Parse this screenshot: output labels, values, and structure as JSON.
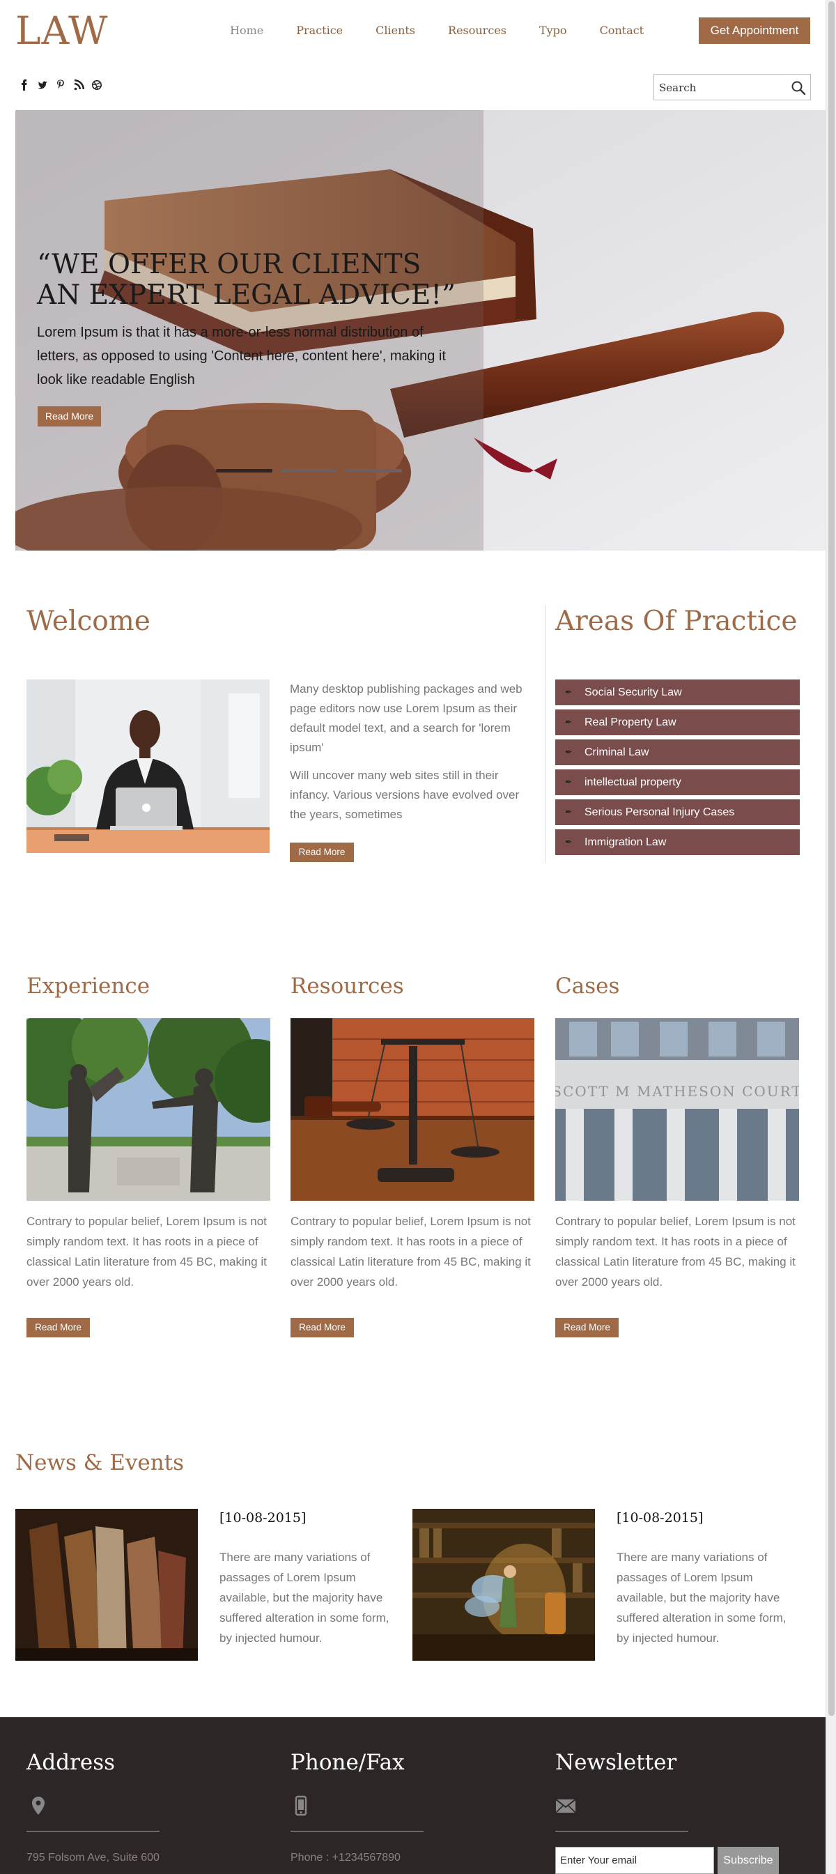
{
  "header": {
    "logo": "LAW",
    "nav": [
      "Home",
      "Practice",
      "Clients",
      "Resources",
      "Typo",
      "Contact"
    ],
    "appointment_button": "Get Appointment"
  },
  "social_icons": [
    "facebook-icon",
    "twitter-icon",
    "pinterest-icon",
    "rss-icon",
    "dribbble-icon"
  ],
  "search": {
    "placeholder": "Search"
  },
  "hero": {
    "quote": "“WE OFFER OUR CLIENTS AN EXPERT LEGAL ADVICE!”",
    "text": "Lorem Ipsum is that it has a more-or-less normal distribution of letters, as opposed to using 'Content here, content here', making it look like readable English",
    "button": "Read More",
    "slides": 3,
    "active_slide": 1
  },
  "welcome": {
    "title": "Welcome",
    "para1": "Many desktop publishing packages and web page editors now use Lorem Ipsum as their default model text, and a search for 'lorem ipsum'",
    "para2": "Will uncover many web sites still in their infancy. Various versions have evolved over the years, sometimes",
    "button": "Read More"
  },
  "practice": {
    "title": "Areas Of Practice",
    "items": [
      "Social Security Law",
      "Real Property Law",
      "Criminal Law",
      "intellectual property",
      "Serious Personal Injury Cases",
      "Immigration Law"
    ]
  },
  "columns": [
    {
      "title": "Experience",
      "text": "Contrary to popular belief, Lorem Ipsum is not simply random text. It has roots in a piece of classical Latin literature from 45 BC, making it over 2000 years old.",
      "button": "Read More"
    },
    {
      "title": "Resources",
      "text": "Contrary to popular belief, Lorem Ipsum is not simply random text. It has roots in a piece of classical Latin literature from 45 BC, making it over 2000 years old.",
      "button": "Read More"
    },
    {
      "title": "Cases",
      "text": "Contrary to popular belief, Lorem Ipsum is not simply random text. It has roots in a piece of classical Latin literature from 45 BC, making it over 2000 years old.",
      "button": "Read More"
    }
  ],
  "cases_image_caption": "SCOTT M MATHESON COURT",
  "news": {
    "title": "News & Events",
    "items": [
      {
        "date": "[10-08-2015]",
        "text": "There are many variations of passages of Lorem Ipsum available, but the majority have suffered alteration in some form, by injected humour."
      },
      {
        "date": "[10-08-2015]",
        "text": "There are many variations of passages of Lorem Ipsum available, but the majority have suffered alteration in some form, by injected humour."
      }
    ]
  },
  "footer": {
    "address_title": "Address",
    "address_line": "795 Folsom Ave, Suite 600",
    "phone_title": "Phone/Fax",
    "phone_line": "Phone : +1234567890",
    "newsletter_title": "Newsletter",
    "email_placeholder": "Enter Your email",
    "subscribe": "Subscribe"
  },
  "colors": {
    "accent": "#a06a47",
    "practice_item": "#7a4c4c",
    "footer": "#2d2626"
  }
}
